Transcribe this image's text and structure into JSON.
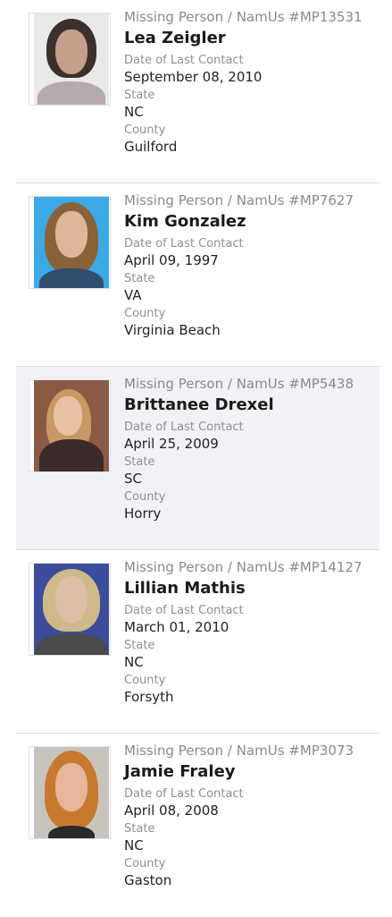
{
  "labels": {
    "date": "Date of Last Contact",
    "state": "State",
    "county": "County"
  },
  "cases": [
    {
      "case_line": "Missing Person / NamUs #MP13531",
      "name": "Lea Zeigler",
      "date": "September 08, 2010",
      "state": "NC",
      "county": "Guilford",
      "highlighted": false,
      "photo": {
        "bg": "#e9e9ea",
        "hair": "#3b302a",
        "face": "#c79d8c",
        "shirt": "#b6a9b0"
      }
    },
    {
      "case_line": "Missing Person / NamUs #MP7627",
      "name": "Kim Gonzalez",
      "date": "April 09, 1997",
      "state": "VA",
      "county": "Virginia Beach",
      "highlighted": false,
      "photo": {
        "bg": "#3aa9e4",
        "hair": "#8a6239",
        "face": "#e0b59a",
        "shirt": "#2f4d6e"
      }
    },
    {
      "case_line": "Missing Person / NamUs #MP5438",
      "name": "Brittanee Drexel",
      "date": "April 25, 2009",
      "state": "SC",
      "county": "Horry",
      "highlighted": true,
      "photo": {
        "bg": "#8b5a45",
        "hair": "#c89a63",
        "face": "#e8c1a4",
        "shirt": "#3a2a2a"
      }
    },
    {
      "case_line": "Missing Person / NamUs #MP14127",
      "name": "Lillian Mathis",
      "date": "March 01, 2010",
      "state": "NC",
      "county": "Forsyth",
      "highlighted": false,
      "photo": {
        "bg": "#3b4c9a",
        "hair": "#cdb98a",
        "face": "#dcc0a6",
        "shirt": "#4a4a4a"
      }
    },
    {
      "case_line": "Missing Person / NamUs #MP3073",
      "name": "Jamie Fraley",
      "date": "April 08, 2008",
      "state": "NC",
      "county": "Gaston",
      "highlighted": false,
      "photo": {
        "bg": "#c7c4bd",
        "hair": "#c77a2f",
        "face": "#e7b69a",
        "shirt": "#2a2a2a"
      }
    }
  ]
}
